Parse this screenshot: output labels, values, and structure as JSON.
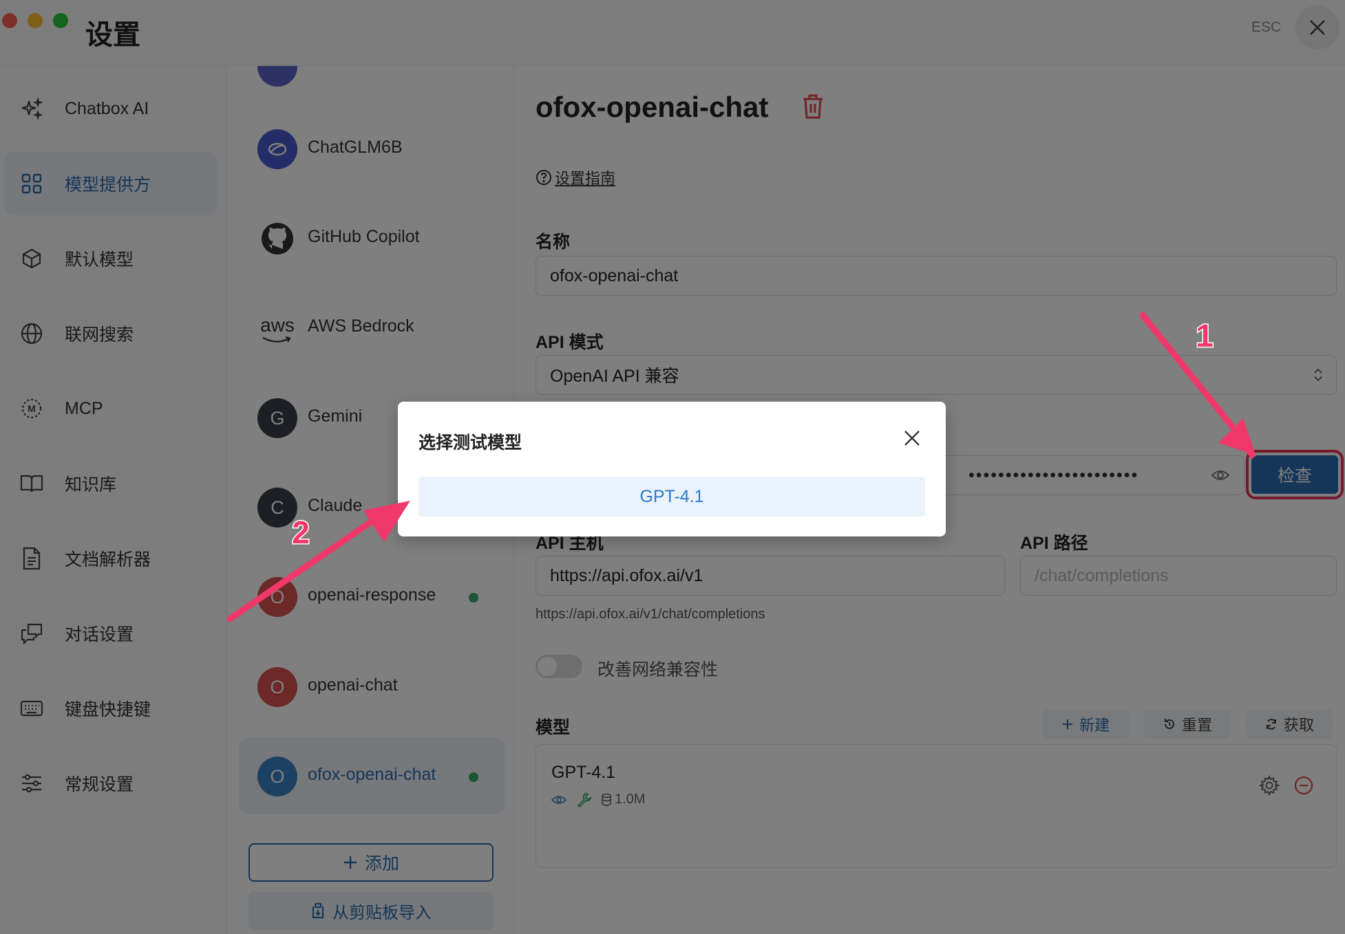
{
  "window": {
    "title": "设置",
    "esc_label": "ESC"
  },
  "sidebar": {
    "items": [
      {
        "label": "Chatbox AI",
        "icon": "sparkle-icon"
      },
      {
        "label": "模型提供方",
        "icon": "grid-icon",
        "active": true
      },
      {
        "label": "默认模型",
        "icon": "cube-icon"
      },
      {
        "label": "联网搜索",
        "icon": "globe-icon"
      },
      {
        "label": "MCP",
        "icon": "mcp-icon"
      },
      {
        "label": "知识库",
        "icon": "book-icon"
      },
      {
        "label": "文档解析器",
        "icon": "document-icon"
      },
      {
        "label": "对话设置",
        "icon": "chat-icon"
      },
      {
        "label": "键盘快捷键",
        "icon": "keyboard-icon"
      },
      {
        "label": "常规设置",
        "icon": "sliders-icon"
      }
    ]
  },
  "providers": {
    "items": [
      {
        "name": "ChatGLM6B",
        "logo": "chatglm-logo"
      },
      {
        "name": "GitHub Copilot",
        "logo": "github-logo"
      },
      {
        "name": "AWS Bedrock",
        "logo": "aws-logo",
        "logo_text": "aws"
      },
      {
        "name": "Gemini",
        "letter": "G"
      },
      {
        "name": "Claude",
        "letter": "C"
      },
      {
        "name": "openai-response",
        "letter": "O",
        "enabled": true
      },
      {
        "name": "openai-chat",
        "letter": "O"
      },
      {
        "name": "ofox-openai-chat",
        "letter": "O",
        "enabled": true,
        "active": true
      }
    ],
    "add_label": "添加",
    "import_label": "从剪贴板导入"
  },
  "main": {
    "title": "ofox-openai-chat",
    "guide_label": "设置指南",
    "name_label": "名称",
    "name_value": "ofox-openai-chat",
    "api_mode_label": "API 模式",
    "api_mode_value": "OpenAI API 兼容",
    "api_key_masked": "•••••••••••••••••••••••",
    "check_label": "检查",
    "api_host_label": "API 主机",
    "api_host_value": "https://api.ofox.ai/v1",
    "api_path_label": "API 路径",
    "api_path_placeholder": "/chat/completions",
    "resolved_url": "https://api.ofox.ai/v1/chat/completions",
    "network_compat_label": "改善网络兼容性",
    "models_label": "模型",
    "new_label": "新建",
    "reset_label": "重置",
    "fetch_label": "获取",
    "models": [
      {
        "name": "GPT-4.1",
        "context": "1.0M"
      }
    ]
  },
  "dialog": {
    "title": "选择测试模型",
    "options": [
      "GPT-4.1"
    ]
  },
  "annotations": {
    "step1": "1",
    "step2": "2",
    "color": "#f0386b"
  }
}
